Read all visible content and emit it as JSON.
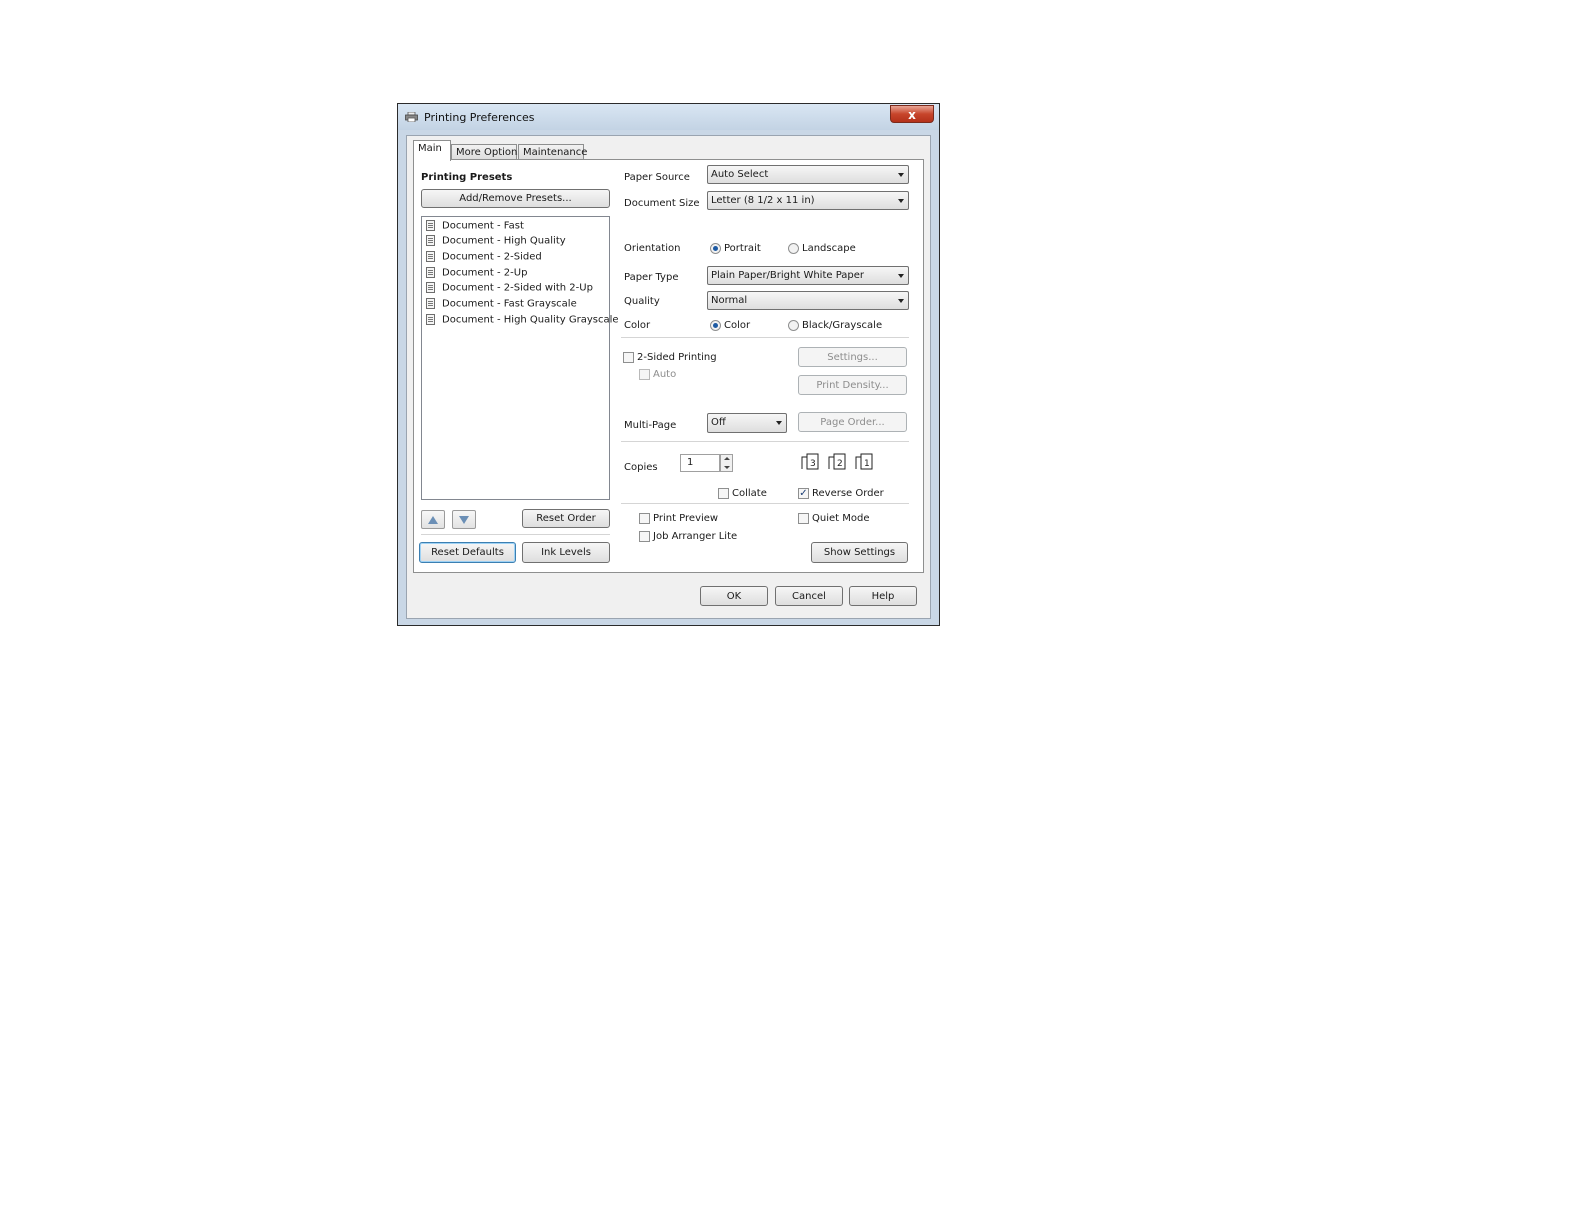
{
  "window": {
    "title": "Printing Preferences",
    "close_glyph": "x"
  },
  "tabs": [
    {
      "label": "Main"
    },
    {
      "label": "More Options"
    },
    {
      "label": "Maintenance"
    }
  ],
  "presets": {
    "heading": "Printing Presets",
    "add_remove_label": "Add/Remove Presets...",
    "items": [
      {
        "label": "Document - Fast"
      },
      {
        "label": "Document - High Quality"
      },
      {
        "label": "Document - 2-Sided"
      },
      {
        "label": "Document - 2-Up"
      },
      {
        "label": "Document - 2-Sided with 2-Up"
      },
      {
        "label": "Document - Fast Grayscale"
      },
      {
        "label": "Document - High Quality Grayscale"
      }
    ],
    "reset_order_label": "Reset Order",
    "reset_defaults_label": "Reset Defaults",
    "ink_levels_label": "Ink Levels"
  },
  "settings": {
    "paper_source": {
      "label": "Paper Source",
      "value": "Auto Select"
    },
    "document_size": {
      "label": "Document Size",
      "value": "Letter (8 1/2 x 11 in)"
    },
    "orientation": {
      "label": "Orientation",
      "portrait": "Portrait",
      "landscape": "Landscape",
      "selected": "Portrait"
    },
    "paper_type": {
      "label": "Paper Type",
      "value": "Plain Paper/Bright White Paper"
    },
    "quality": {
      "label": "Quality",
      "value": "Normal"
    },
    "color": {
      "label": "Color",
      "color": "Color",
      "bw": "Black/Grayscale",
      "selected": "Color"
    },
    "two_sided": {
      "label": "2-Sided Printing",
      "auto": "Auto",
      "settings_label": "Settings...",
      "density_label": "Print Density..."
    },
    "multi_page": {
      "label": "Multi-Page",
      "value": "Off",
      "page_order_label": "Page Order..."
    },
    "copies": {
      "label": "Copies",
      "value": "1",
      "collate": "Collate",
      "reverse_order": "Reverse Order"
    },
    "print_preview": "Print Preview",
    "job_arranger": "Job Arranger Lite",
    "quiet_mode": "Quiet Mode",
    "show_settings_label": "Show Settings"
  },
  "footer": {
    "ok_label": "OK",
    "cancel_label": "Cancel",
    "help_label": "Help"
  },
  "check_glyph": "✓",
  "page_numbers": [
    "3",
    "2",
    "1"
  ]
}
